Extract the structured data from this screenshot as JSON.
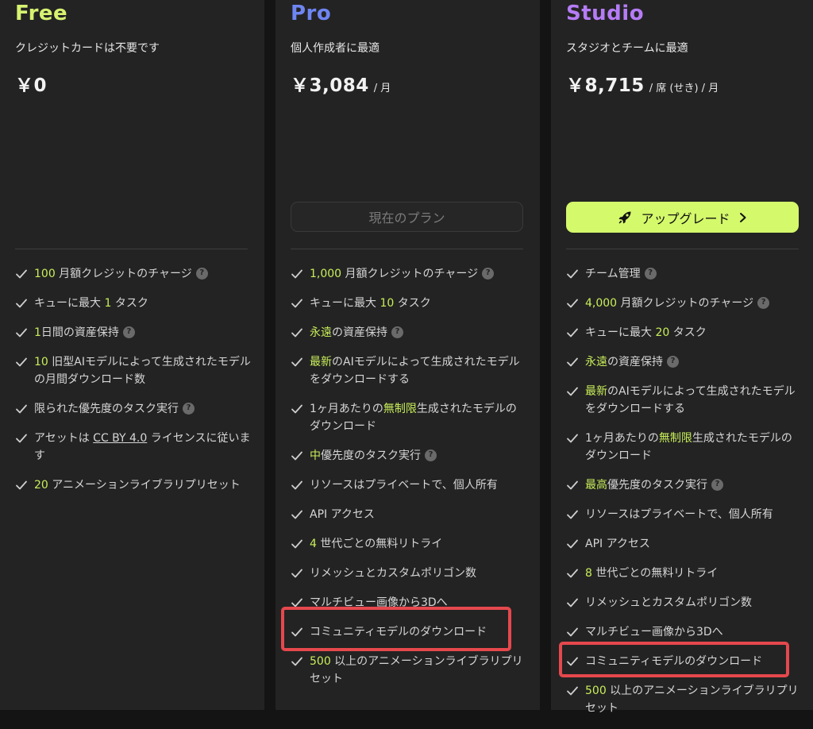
{
  "colors": {
    "free_title": "#d6f270",
    "pro_title": "#6e85f2",
    "studio_title": "#b57cf6",
    "highlight": "#c8ee5a",
    "upgrade_bg": "#d4f96b"
  },
  "plans": {
    "free": {
      "title": "Free",
      "subtitle": "クレジットカードは不要です",
      "price": "￥0",
      "features": [
        {
          "a": "100",
          "b": " 月額クレジットのチャージ",
          "q": "?"
        },
        {
          "a": "キューに最大 ",
          "b": "1",
          "c": " タスク"
        },
        {
          "a": "1",
          "b": "日間の資産保持",
          "q": "?"
        },
        {
          "a": "10",
          "b": " 旧型AIモデルによって生成されたモデルの月間ダウンロード数"
        },
        {
          "a": "限られた優先度のタスク実行",
          "q": "?"
        },
        {
          "a": "アセットは ",
          "b": "CC BY 4.0",
          "c": " ライセンスに従います"
        },
        {
          "a": "20",
          "b": " アニメーションライブラリプリセット"
        }
      ]
    },
    "pro": {
      "title": "Pro",
      "subtitle": "個人作成者に最適",
      "price": "￥3,084",
      "unit": "/ 月",
      "button": "現在のプラン",
      "features": [
        {
          "a": "1,000",
          "b": " 月額クレジットのチャージ",
          "q": "?"
        },
        {
          "a": "キューに最大 ",
          "b": "10",
          "c": " タスク"
        },
        {
          "a": "永遠",
          "b": "の資産保持",
          "q": "?"
        },
        {
          "a": "最新",
          "b": "のAIモデルによって生成されたモデルをダウンロードする"
        },
        {
          "a": "1ヶ月あたりの",
          "b": "無制限",
          "c": "生成されたモデルのダウンロード"
        },
        {
          "a": "中",
          "b": "優先度のタスク実行",
          "q": "?"
        },
        {
          "a": "リソースはプライベートで、個人所有"
        },
        {
          "a": "API アクセス"
        },
        {
          "a": "4",
          "b": " 世代ごとの無料リトライ"
        },
        {
          "a": "リメッシュとカスタムポリゴン数"
        },
        {
          "a": "マルチビュー画像から3Dへ"
        },
        {
          "a": "コミュニティモデルのダウンロード"
        },
        {
          "a": "500",
          "b": " 以上のアニメーションライブラリプリセット"
        }
      ]
    },
    "studio": {
      "title": "Studio",
      "subtitle": "スタジオとチームに最適",
      "price": "￥8,715",
      "unit": "/ 席 (せき) / 月",
      "button": "アップグレード",
      "features": [
        {
          "a": "チーム管理",
          "q": "?"
        },
        {
          "a": "4,000",
          "b": " 月額クレジットのチャージ",
          "q": "?"
        },
        {
          "a": "キューに最大 ",
          "b": "20",
          "c": " タスク"
        },
        {
          "a": "永遠",
          "b": "の資産保持",
          "q": "?"
        },
        {
          "a": "最新",
          "b": "のAIモデルによって生成されたモデルをダウンロードする"
        },
        {
          "a": "1ヶ月あたりの",
          "b": "無制限",
          "c": "生成されたモデルのダウンロード"
        },
        {
          "a": "最高",
          "b": "優先度のタスク実行",
          "q": "?"
        },
        {
          "a": "リソースはプライベートで、個人所有"
        },
        {
          "a": "API アクセス"
        },
        {
          "a": "8",
          "b": " 世代ごとの無料リトライ"
        },
        {
          "a": "リメッシュとカスタムポリゴン数"
        },
        {
          "a": "マルチビュー画像から3Dへ"
        },
        {
          "a": "コミュニティモデルのダウンロード"
        },
        {
          "a": "500",
          "b": " 以上のアニメーションライブラリプリセット"
        }
      ]
    }
  }
}
